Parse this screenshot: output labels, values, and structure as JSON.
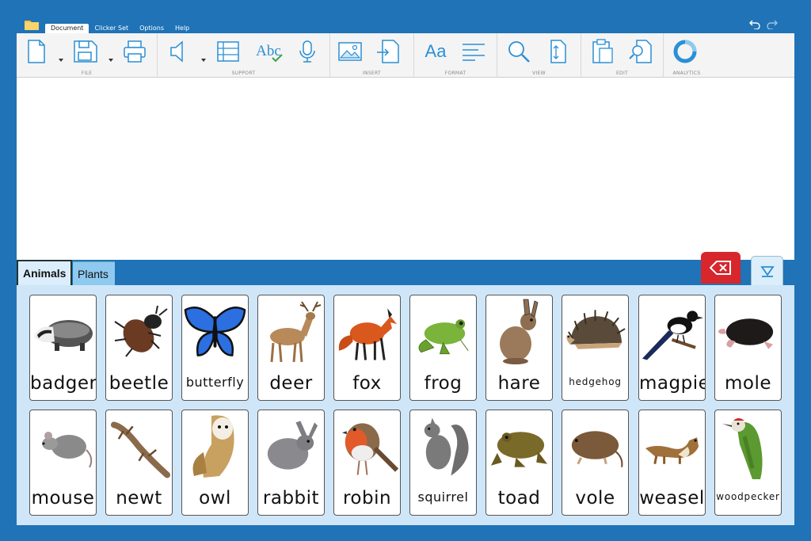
{
  "menu": {
    "tabs": [
      "Document",
      "Clicker Set",
      "Options",
      "Help"
    ],
    "active": "Document"
  },
  "ribbon": {
    "groups": [
      "FILE",
      "SUPPORT",
      "INSERT",
      "FORMAT",
      "VIEW",
      "EDIT",
      "ANALYTICS"
    ],
    "format_text": "Aa",
    "spell_text": "Abc"
  },
  "tabs": [
    {
      "label": "Animals",
      "active": true
    },
    {
      "label": "Plants",
      "active": false
    }
  ],
  "cells": [
    {
      "label": "badger",
      "icon": "badger-picture"
    },
    {
      "label": "beetle",
      "icon": "beetle-picture"
    },
    {
      "label": "butterfly",
      "icon": "butterfly-picture"
    },
    {
      "label": "deer",
      "icon": "deer-picture"
    },
    {
      "label": "fox",
      "icon": "fox-picture"
    },
    {
      "label": "frog",
      "icon": "frog-picture"
    },
    {
      "label": "hare",
      "icon": "hare-picture"
    },
    {
      "label": "hedgehog",
      "icon": "hedgehog-picture"
    },
    {
      "label": "magpie",
      "icon": "magpie-picture"
    },
    {
      "label": "mole",
      "icon": "mole-picture"
    },
    {
      "label": "mouse",
      "icon": "mouse-picture"
    },
    {
      "label": "newt",
      "icon": "newt-picture"
    },
    {
      "label": "owl",
      "icon": "owl-picture"
    },
    {
      "label": "rabbit",
      "icon": "rabbit-picture"
    },
    {
      "label": "robin",
      "icon": "robin-picture"
    },
    {
      "label": "squirrel",
      "icon": "squirrel-picture"
    },
    {
      "label": "toad",
      "icon": "toad-picture"
    },
    {
      "label": "vole",
      "icon": "vole-picture"
    },
    {
      "label": "weasel",
      "icon": "weasel-picture"
    },
    {
      "label": "woodpecker",
      "icon": "woodpecker-picture"
    }
  ],
  "colors": {
    "frame": "#1f73b6",
    "grid_bg": "#cfe6f8",
    "delete": "#d7262c",
    "accent": "#2a8fd6"
  }
}
